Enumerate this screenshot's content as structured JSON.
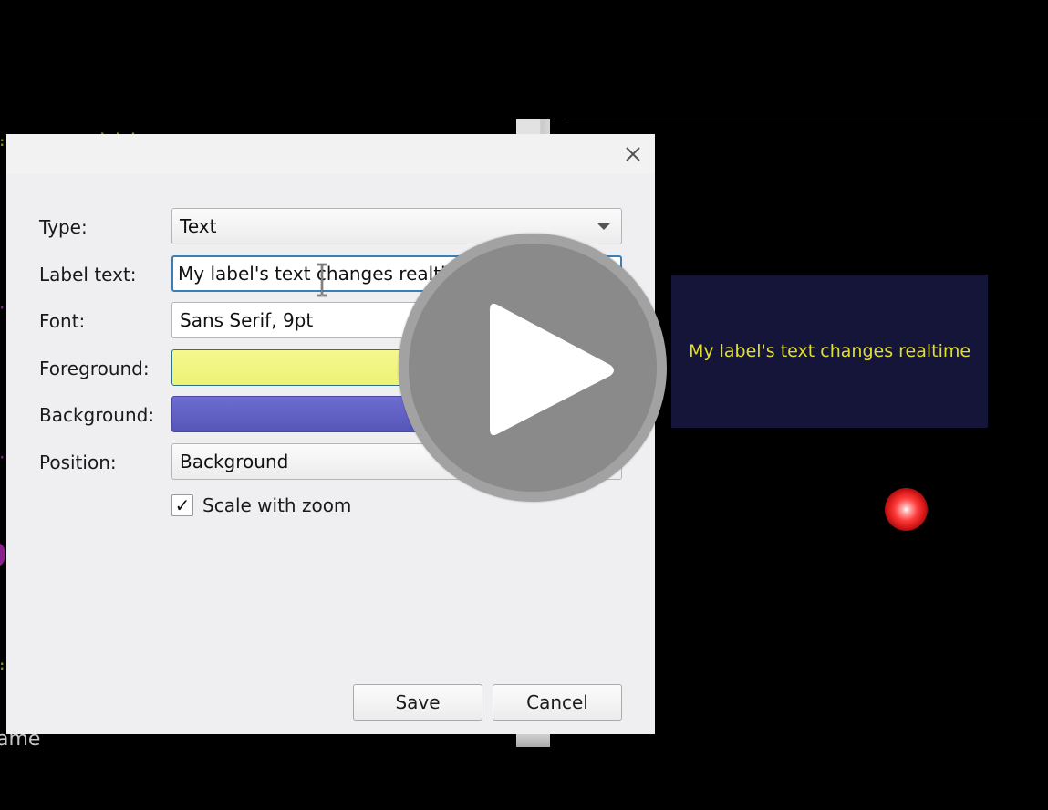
{
  "background": {
    "preview_label_text": "My label's text changes realtime",
    "partial_text_bottom_left": "ame",
    "preview_colors": {
      "foreground": "#e0e02a",
      "background": "#15153a"
    }
  },
  "dialog": {
    "close_icon": "close-icon",
    "fields": {
      "type": {
        "label": "Type:",
        "value": "Text"
      },
      "label_text": {
        "label": "Label text:",
        "value": "My label's text changes realtime"
      },
      "font": {
        "label": "Font:",
        "value": "Sans Serif, 9pt"
      },
      "foreground": {
        "label": "Foreground:",
        "color": "#f0f582"
      },
      "background": {
        "label": "Background:",
        "color": "#5f5fc4"
      },
      "position": {
        "label": "Position:",
        "value": "Background"
      }
    },
    "scale_with_zoom": {
      "label": "Scale with zoom",
      "checked": true,
      "check_glyph": "✓"
    },
    "buttons": {
      "save": "Save",
      "cancel": "Cancel"
    }
  },
  "overlay": {
    "icon": "play-icon"
  }
}
